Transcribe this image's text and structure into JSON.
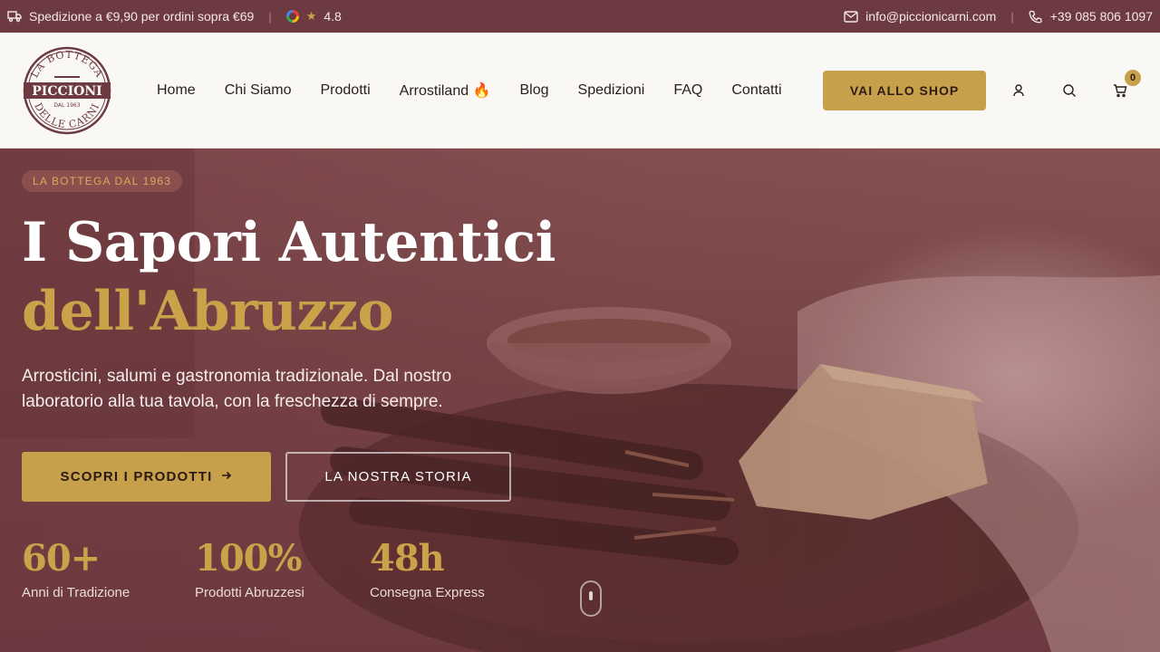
{
  "topbar": {
    "shipping_text": "Spedizione a €9,90 per ordini sopra €69",
    "rating": "4.8",
    "email": "info@piccionicarni.com",
    "phone": "+39 085 806 1097"
  },
  "logo": {
    "top_text": "LA BOTTEGA",
    "name": "PICCIONI",
    "since": "DAL 1963",
    "bottom_text": "DELLE CARNI"
  },
  "nav": {
    "items": [
      "Home",
      "Chi Siamo",
      "Prodotti",
      "Arrostiland 🔥",
      "Blog",
      "Spedizioni",
      "FAQ",
      "Contatti"
    ]
  },
  "header": {
    "shop_button": "VAI ALLO SHOP",
    "cart_count": "0"
  },
  "hero": {
    "badge": "LA BOTTEGA DAL 1963",
    "title_line1": "I Sapori Autentici",
    "title_line2": "dell'Abruzzo",
    "subtitle": "Arrosticini, salumi e gastronomia tradizionale. Dal nostro laboratorio alla tua tavola, con la freschezza di sempre.",
    "primary_button": "SCOPRI I PRODOTTI",
    "secondary_button": "LA NOSTRA STORIA",
    "stats": [
      {
        "value": "60+",
        "label": "Anni di Tradizione"
      },
      {
        "value": "100%",
        "label": "Prodotti Abruzzesi"
      },
      {
        "value": "48h",
        "label": "Consegna Express"
      }
    ]
  },
  "colors": {
    "topbar_bg": "#6e3a42",
    "accent_gold": "#c6a04a",
    "header_bg": "#faf8f4"
  }
}
